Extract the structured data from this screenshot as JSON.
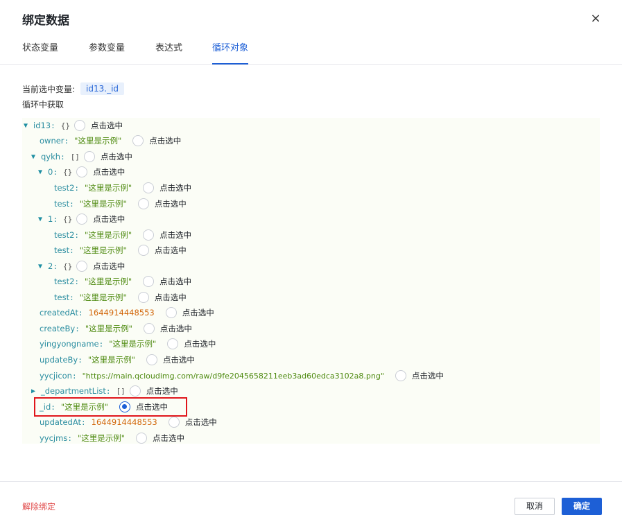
{
  "dialog": {
    "title": "绑定数据",
    "close_glyph": "×"
  },
  "tabs": [
    {
      "label": "状态变量",
      "active": false
    },
    {
      "label": "参数变量",
      "active": false
    },
    {
      "label": "表达式",
      "active": false
    },
    {
      "label": "循环对象",
      "active": true
    }
  ],
  "current": {
    "label": "当前选中变量:",
    "value": "id13._id"
  },
  "section_label": "循环中获取",
  "radio_label": "点击选中",
  "tree": {
    "root": {
      "key": "id13",
      "brace": "{}"
    },
    "owner": {
      "key": "owner",
      "value": "\"这里是示例\""
    },
    "qykh": {
      "key": "qykh",
      "brace": "[]"
    },
    "items": [
      {
        "key": "0",
        "brace": "{}",
        "test2": "\"这里是示例\"",
        "test": "\"这里是示例\""
      },
      {
        "key": "1",
        "brace": "{}",
        "test2": "\"这里是示例\"",
        "test": "\"这里是示例\""
      },
      {
        "key": "2",
        "brace": "{}",
        "test2": "\"这里是示例\"",
        "test": "\"这里是示例\""
      }
    ],
    "test2_key": "test2",
    "test_key": "test",
    "createdAt": {
      "key": "createdAt",
      "value": "1644914448553"
    },
    "createBy": {
      "key": "createBy",
      "value": "\"这里是示例\""
    },
    "yingyongname": {
      "key": "yingyongname",
      "value": "\"这里是示例\""
    },
    "updateBy": {
      "key": "updateBy",
      "value": "\"这里是示例\""
    },
    "yycjicon": {
      "key": "yycjicon",
      "value": "\"https://main.qcloudimg.com/raw/d9fe2045658211eeb3ad60edca3102a8.png\""
    },
    "departmentList": {
      "key": "_departmentList",
      "brace": "[]"
    },
    "id": {
      "key": "_id",
      "value": "\"这里是示例\"",
      "selected": true
    },
    "updatedAt": {
      "key": "updatedAt",
      "value": "1644914448553"
    },
    "yycjms": {
      "key": "yycjms",
      "value": "\"这里是示例\""
    }
  },
  "footer": {
    "unbind_label": "解除绑定",
    "cancel_label": "取消",
    "confirm_label": "确定"
  },
  "colors": {
    "accent": "#1d5fd6",
    "danger": "#e04848",
    "key": "#2a8da0",
    "string": "#4e8a10",
    "number": "#d2670b",
    "highlight": "#e0151b"
  }
}
